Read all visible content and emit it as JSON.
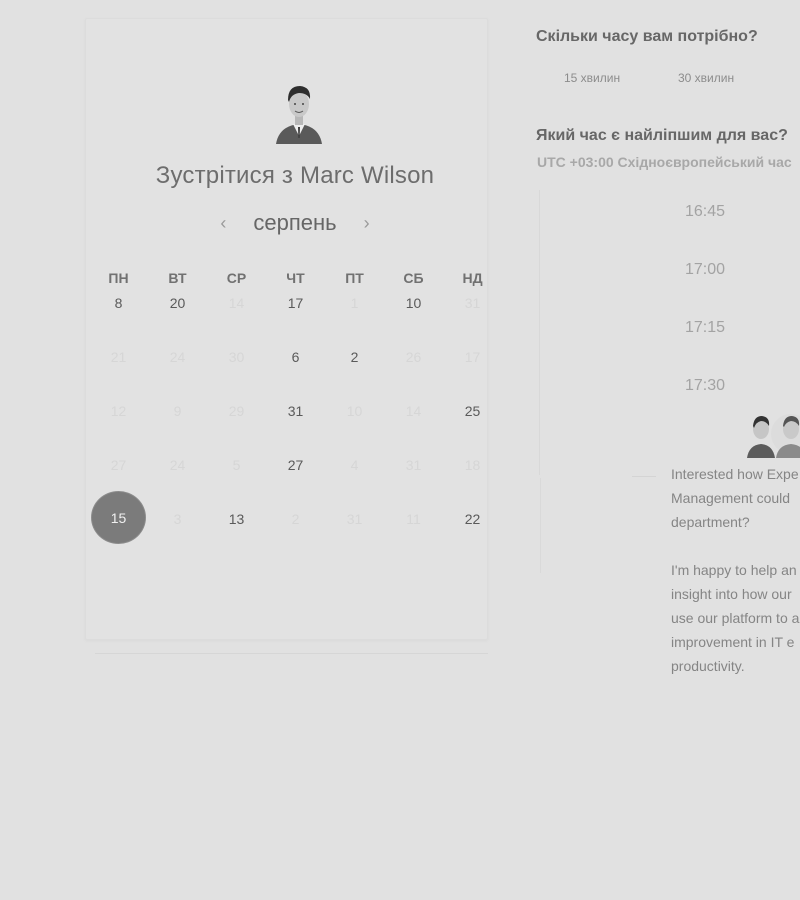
{
  "host": {
    "title": "Зустрітися з Marc Wilson"
  },
  "calendar": {
    "month": "серпень",
    "prev_icon": "‹",
    "next_icon": "›",
    "weekdays": [
      "ПН",
      "ВТ",
      "СР",
      "ЧТ",
      "ПТ",
      "СБ",
      "НД"
    ],
    "rows": [
      [
        {
          "t": "8",
          "on": true
        },
        {
          "t": "20",
          "on": true
        },
        {
          "t": "14",
          "on": false
        },
        {
          "t": "17",
          "on": true
        },
        {
          "t": "1",
          "on": false
        },
        {
          "t": "10",
          "on": true
        },
        {
          "t": "31",
          "on": false
        }
      ],
      [
        {
          "t": "21",
          "on": false
        },
        {
          "t": "24",
          "on": false
        },
        {
          "t": "30",
          "on": false
        },
        {
          "t": "6",
          "on": true
        },
        {
          "t": "2",
          "on": true
        },
        {
          "t": "26",
          "on": false
        },
        {
          "t": "17",
          "on": false
        }
      ],
      [
        {
          "t": "12",
          "on": false
        },
        {
          "t": "9",
          "on": false
        },
        {
          "t": "29",
          "on": false
        },
        {
          "t": "31",
          "on": true
        },
        {
          "t": "10",
          "on": false
        },
        {
          "t": "14",
          "on": false
        },
        {
          "t": "25",
          "on": true
        }
      ],
      [
        {
          "t": "27",
          "on": false
        },
        {
          "t": "24",
          "on": false
        },
        {
          "t": "5",
          "on": false
        },
        {
          "t": "27",
          "on": true
        },
        {
          "t": "4",
          "on": false
        },
        {
          "t": "31",
          "on": false
        },
        {
          "t": "18",
          "on": false
        }
      ],
      [
        {
          "t": "15",
          "on": true,
          "selected": true
        },
        {
          "t": "3",
          "on": false
        },
        {
          "t": "13",
          "on": true
        },
        {
          "t": "2",
          "on": false
        },
        {
          "t": "31",
          "on": false
        },
        {
          "t": "11",
          "on": false
        },
        {
          "t": "22",
          "on": true
        }
      ]
    ],
    "selected_day": "15"
  },
  "duration": {
    "question": "Скільки часу вам потрібно?",
    "options": [
      "15 хвилин",
      "30 хвилин"
    ]
  },
  "time": {
    "question": "Який час є найліпшим для вас?",
    "timezone": "UTC +03:00 Східноєвропейський час",
    "slots": [
      "16:45",
      "17:00",
      "17:15",
      "17:30"
    ]
  },
  "message": {
    "para1": [
      "Interested how Expe",
      "Management could",
      "department?"
    ],
    "para2": [
      "I'm happy to help an",
      "insight into how our",
      "use our platform to a",
      "improvement in IT e",
      "productivity."
    ]
  },
  "colors": {
    "background": "#e1e1e1",
    "selected": "#7b7b7b"
  }
}
